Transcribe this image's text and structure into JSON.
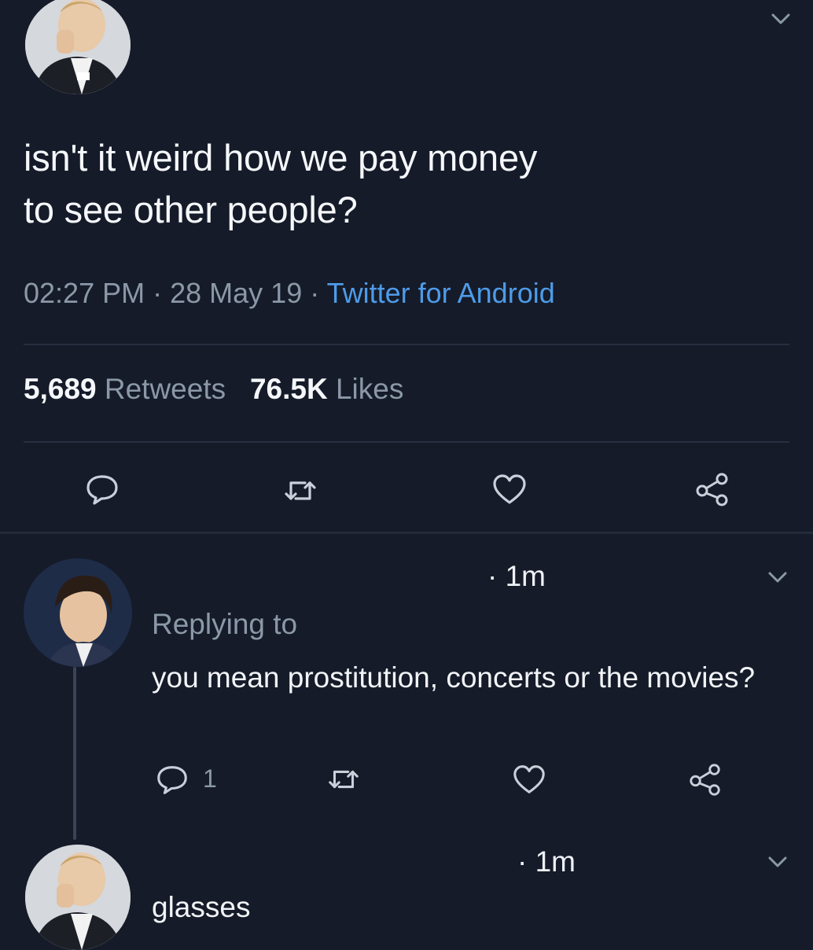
{
  "main_tweet": {
    "text_line1": "isn't it weird how we pay money",
    "text_line2": "to see other people?",
    "time": "02:27 PM",
    "date": "28 May 19",
    "source": "Twitter for Android",
    "separator": "·",
    "retweets_count": "5,689",
    "retweets_label": "Retweets",
    "likes_count": "76.5K",
    "likes_label": "Likes"
  },
  "reply1": {
    "time": "· 1m",
    "replying_to": "Replying to",
    "text": "you mean prostitution, concerts or the movies?",
    "reply_count": "1"
  },
  "reply2": {
    "time": "· 1m",
    "text": "glasses"
  },
  "icons": {
    "reply": "speech-bubble-icon",
    "retweet": "retweet-icon",
    "like": "heart-icon",
    "share": "share-icon",
    "menu": "chevron-down-icon"
  },
  "colors": {
    "background": "#151b29",
    "text": "#f5f7fa",
    "secondary": "#8b98a8",
    "link": "#4e9be8",
    "icon": "#c8d0da"
  }
}
